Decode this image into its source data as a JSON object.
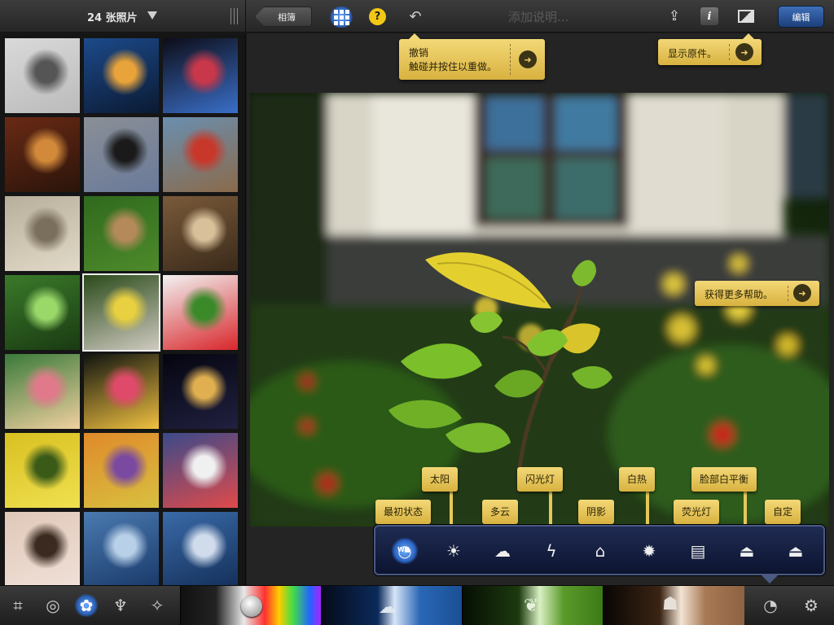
{
  "header": {
    "photo_count": "24 张照片",
    "album_button": "相簿",
    "help_glyph": "?",
    "caption_placeholder": "添加说明...",
    "info_glyph": "i",
    "edit_button": "编辑"
  },
  "tooltips": {
    "undo_title": "撤销",
    "undo_body": "触碰并按住以重做。",
    "show_original": "显示原件。",
    "more_help": "获得更多帮助。"
  },
  "wb_presets": [
    {
      "label": "最初状态",
      "icon": "wb-original-icon"
    },
    {
      "label": "太阳",
      "icon": "sun-icon"
    },
    {
      "label": "多云",
      "icon": "cloud-icon"
    },
    {
      "label": "闪光灯",
      "icon": "flash-icon"
    },
    {
      "label": "阴影",
      "icon": "shade-icon"
    },
    {
      "label": "白热",
      "icon": "incandescent-icon"
    },
    {
      "label": "荧光灯",
      "icon": "fluorescent-icon"
    },
    {
      "label": "脸部白平衡",
      "icon": "face-balance-icon"
    },
    {
      "label": "自定",
      "icon": "custom-icon"
    }
  ],
  "wb_active_badge": "WB",
  "thumbnails": [
    "skyscraper-bw",
    "sunset-sky",
    "canon-store-night",
    "mojito-bar",
    "bird-on-pavement",
    "tram-street",
    "stone-columns",
    "leaf-on-grass",
    "mannequin-shop",
    "green-tree",
    "yellow-flower-plant",
    "red-flowers",
    "pink-gerbera",
    "pink-zinnia",
    "building-night",
    "yellow-chrysanthemum",
    "flower-hill",
    "flower-vase",
    "girl-portrait",
    "blue-sea",
    "cloud-sea"
  ],
  "selected_thumbnail": "yellow-flower-plant",
  "colors": {
    "accent_blue": "#2a5fb5",
    "tooltip_yellow": "#f3d877",
    "panel_navy": "#0c1430"
  }
}
